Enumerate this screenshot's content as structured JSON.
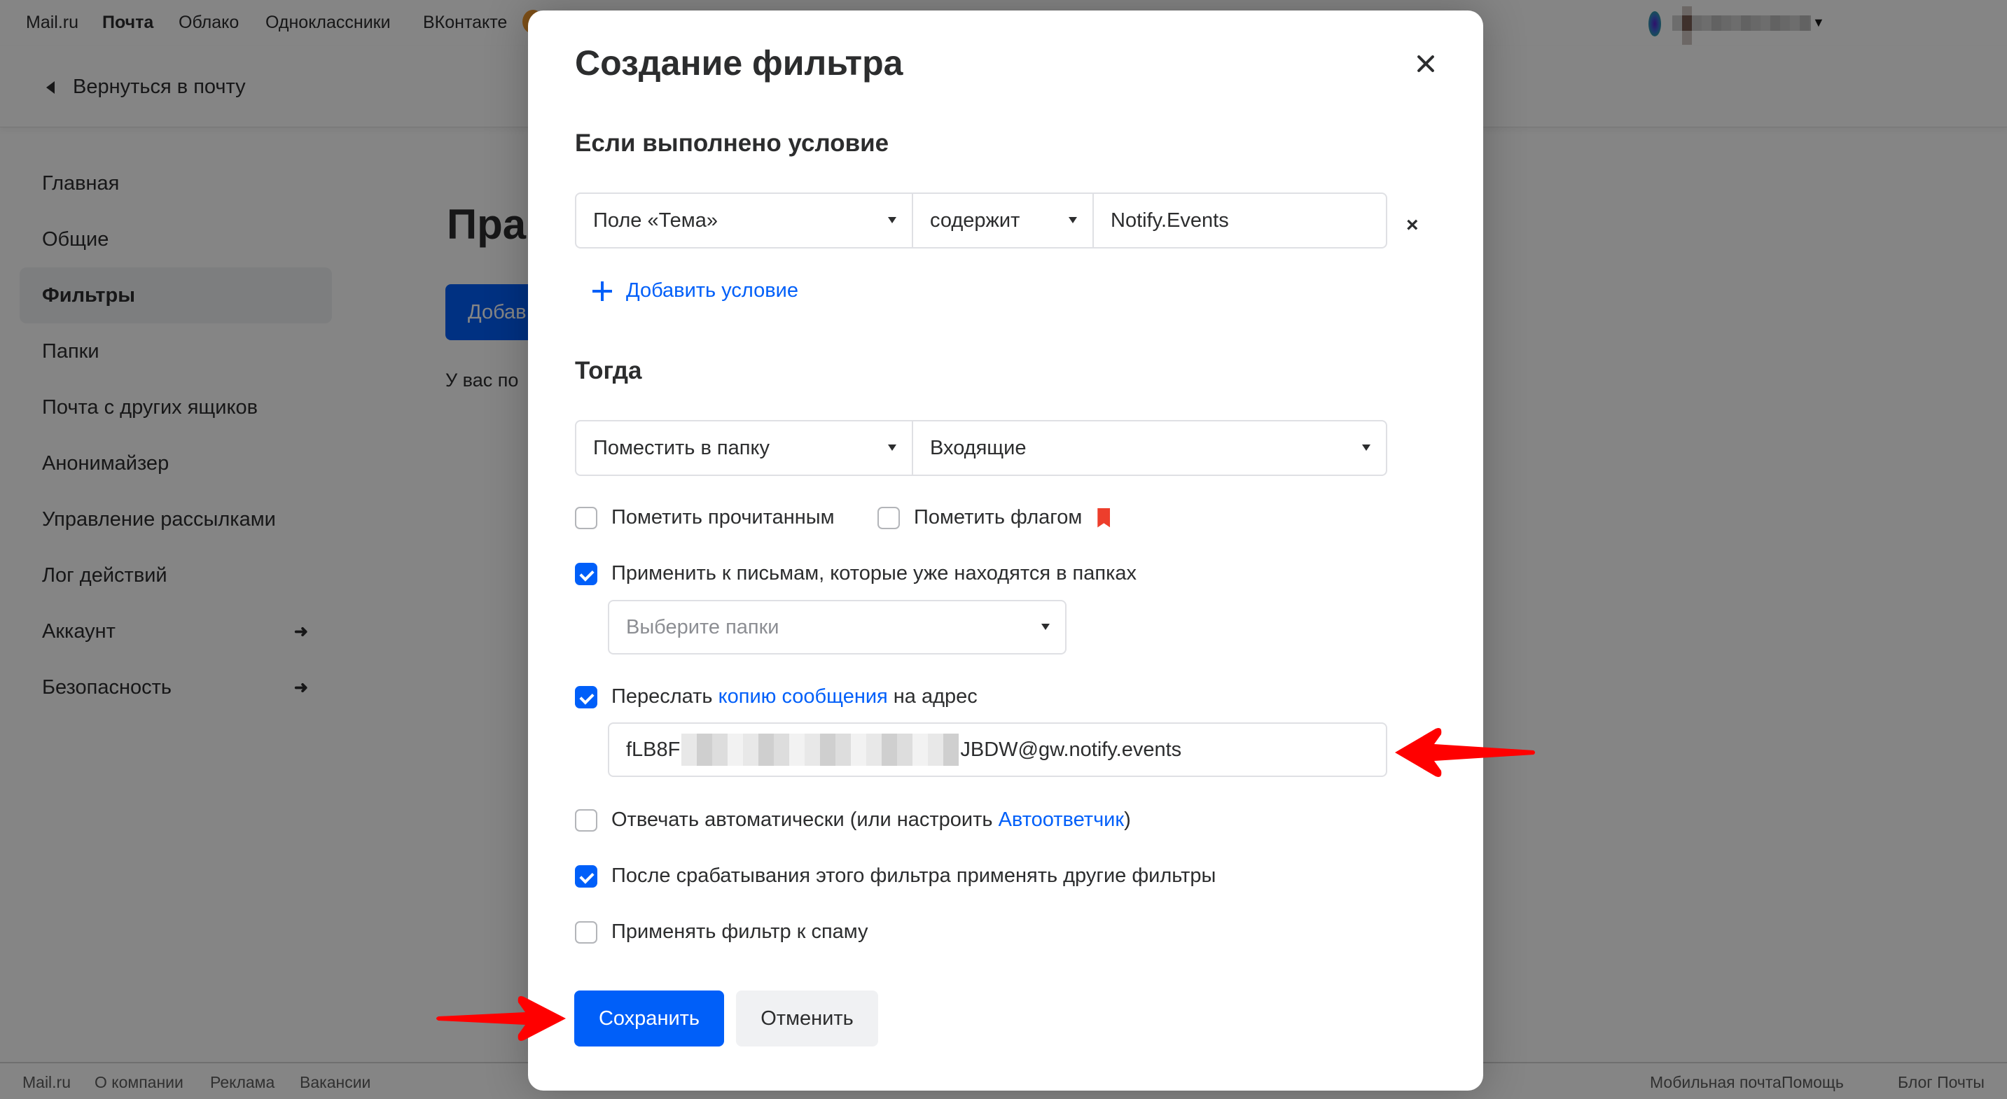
{
  "topnav": {
    "links": [
      "Mail.ru",
      "Почта",
      "Облако",
      "Одноклассники",
      "ВКонтакте"
    ],
    "active_index": 1
  },
  "back_link": "Вернуться в почту",
  "sidebar": {
    "items": [
      {
        "label": "Главная",
        "arrow": false
      },
      {
        "label": "Общие",
        "arrow": false
      },
      {
        "label": "Фильтры",
        "arrow": false,
        "active": true
      },
      {
        "label": "Папки",
        "arrow": false
      },
      {
        "label": "Почта с других ящиков",
        "arrow": false
      },
      {
        "label": "Анонимайзер",
        "arrow": false
      },
      {
        "label": "Управление рассылками",
        "arrow": false
      },
      {
        "label": "Лог действий",
        "arrow": false
      },
      {
        "label": "Аккаунт",
        "arrow": true
      },
      {
        "label": "Безопасность",
        "arrow": true
      }
    ],
    "arrow_glyph": "➜"
  },
  "main": {
    "title_partial": "Пра",
    "button_partial": "Добав",
    "text_partial": "У вас по"
  },
  "footer": {
    "left_links": [
      "Mail.ru",
      "О компании",
      "Реклама",
      "Вакансии"
    ],
    "right_links": [
      "Мобильная почта",
      "Помощь",
      "Блог Почты"
    ]
  },
  "modal": {
    "title": "Создание фильтра",
    "condition_section": "Если выполнено условие",
    "condition": {
      "field": "Поле «Тема»",
      "operator": "содержит",
      "value": "Notify.Events",
      "remove_glyph": "×"
    },
    "add_condition": "Добавить условие",
    "then_section": "Тогда",
    "action": {
      "type": "Поместить в папку",
      "folder": "Входящие"
    },
    "options": {
      "mark_read": {
        "label": "Пометить прочитанным",
        "checked": false
      },
      "mark_flag": {
        "label": "Пометить флагом",
        "checked": false
      },
      "apply_existing": {
        "label": "Применить к письмам, которые уже находятся в папках",
        "checked": true
      },
      "folders_placeholder": "Выберите папки",
      "forward": {
        "label_before": "Переслать",
        "link": "копию сообщения",
        "label_after": "на адрес",
        "checked": true,
        "address_prefix": "fLB8F",
        "address_suffix": "JBDW@gw.notify.events"
      },
      "auto_reply": {
        "label_before": "Отвечать автоматически (или настроить",
        "link": "Автоответчик",
        "label_after": ")",
        "checked": false
      },
      "continue_filters": {
        "label": "После срабатывания этого фильтра применять другие фильтры",
        "checked": true
      },
      "apply_spam": {
        "label": "Применять фильтр к спаму",
        "checked": false
      }
    },
    "save": "Сохранить",
    "cancel": "Отменить"
  },
  "colors": {
    "accent": "#005ff9",
    "flag": "#ed3e2c",
    "annotation_arrow": "#ff0000",
    "overlay": "rgba(0,0,0,0.48)"
  }
}
